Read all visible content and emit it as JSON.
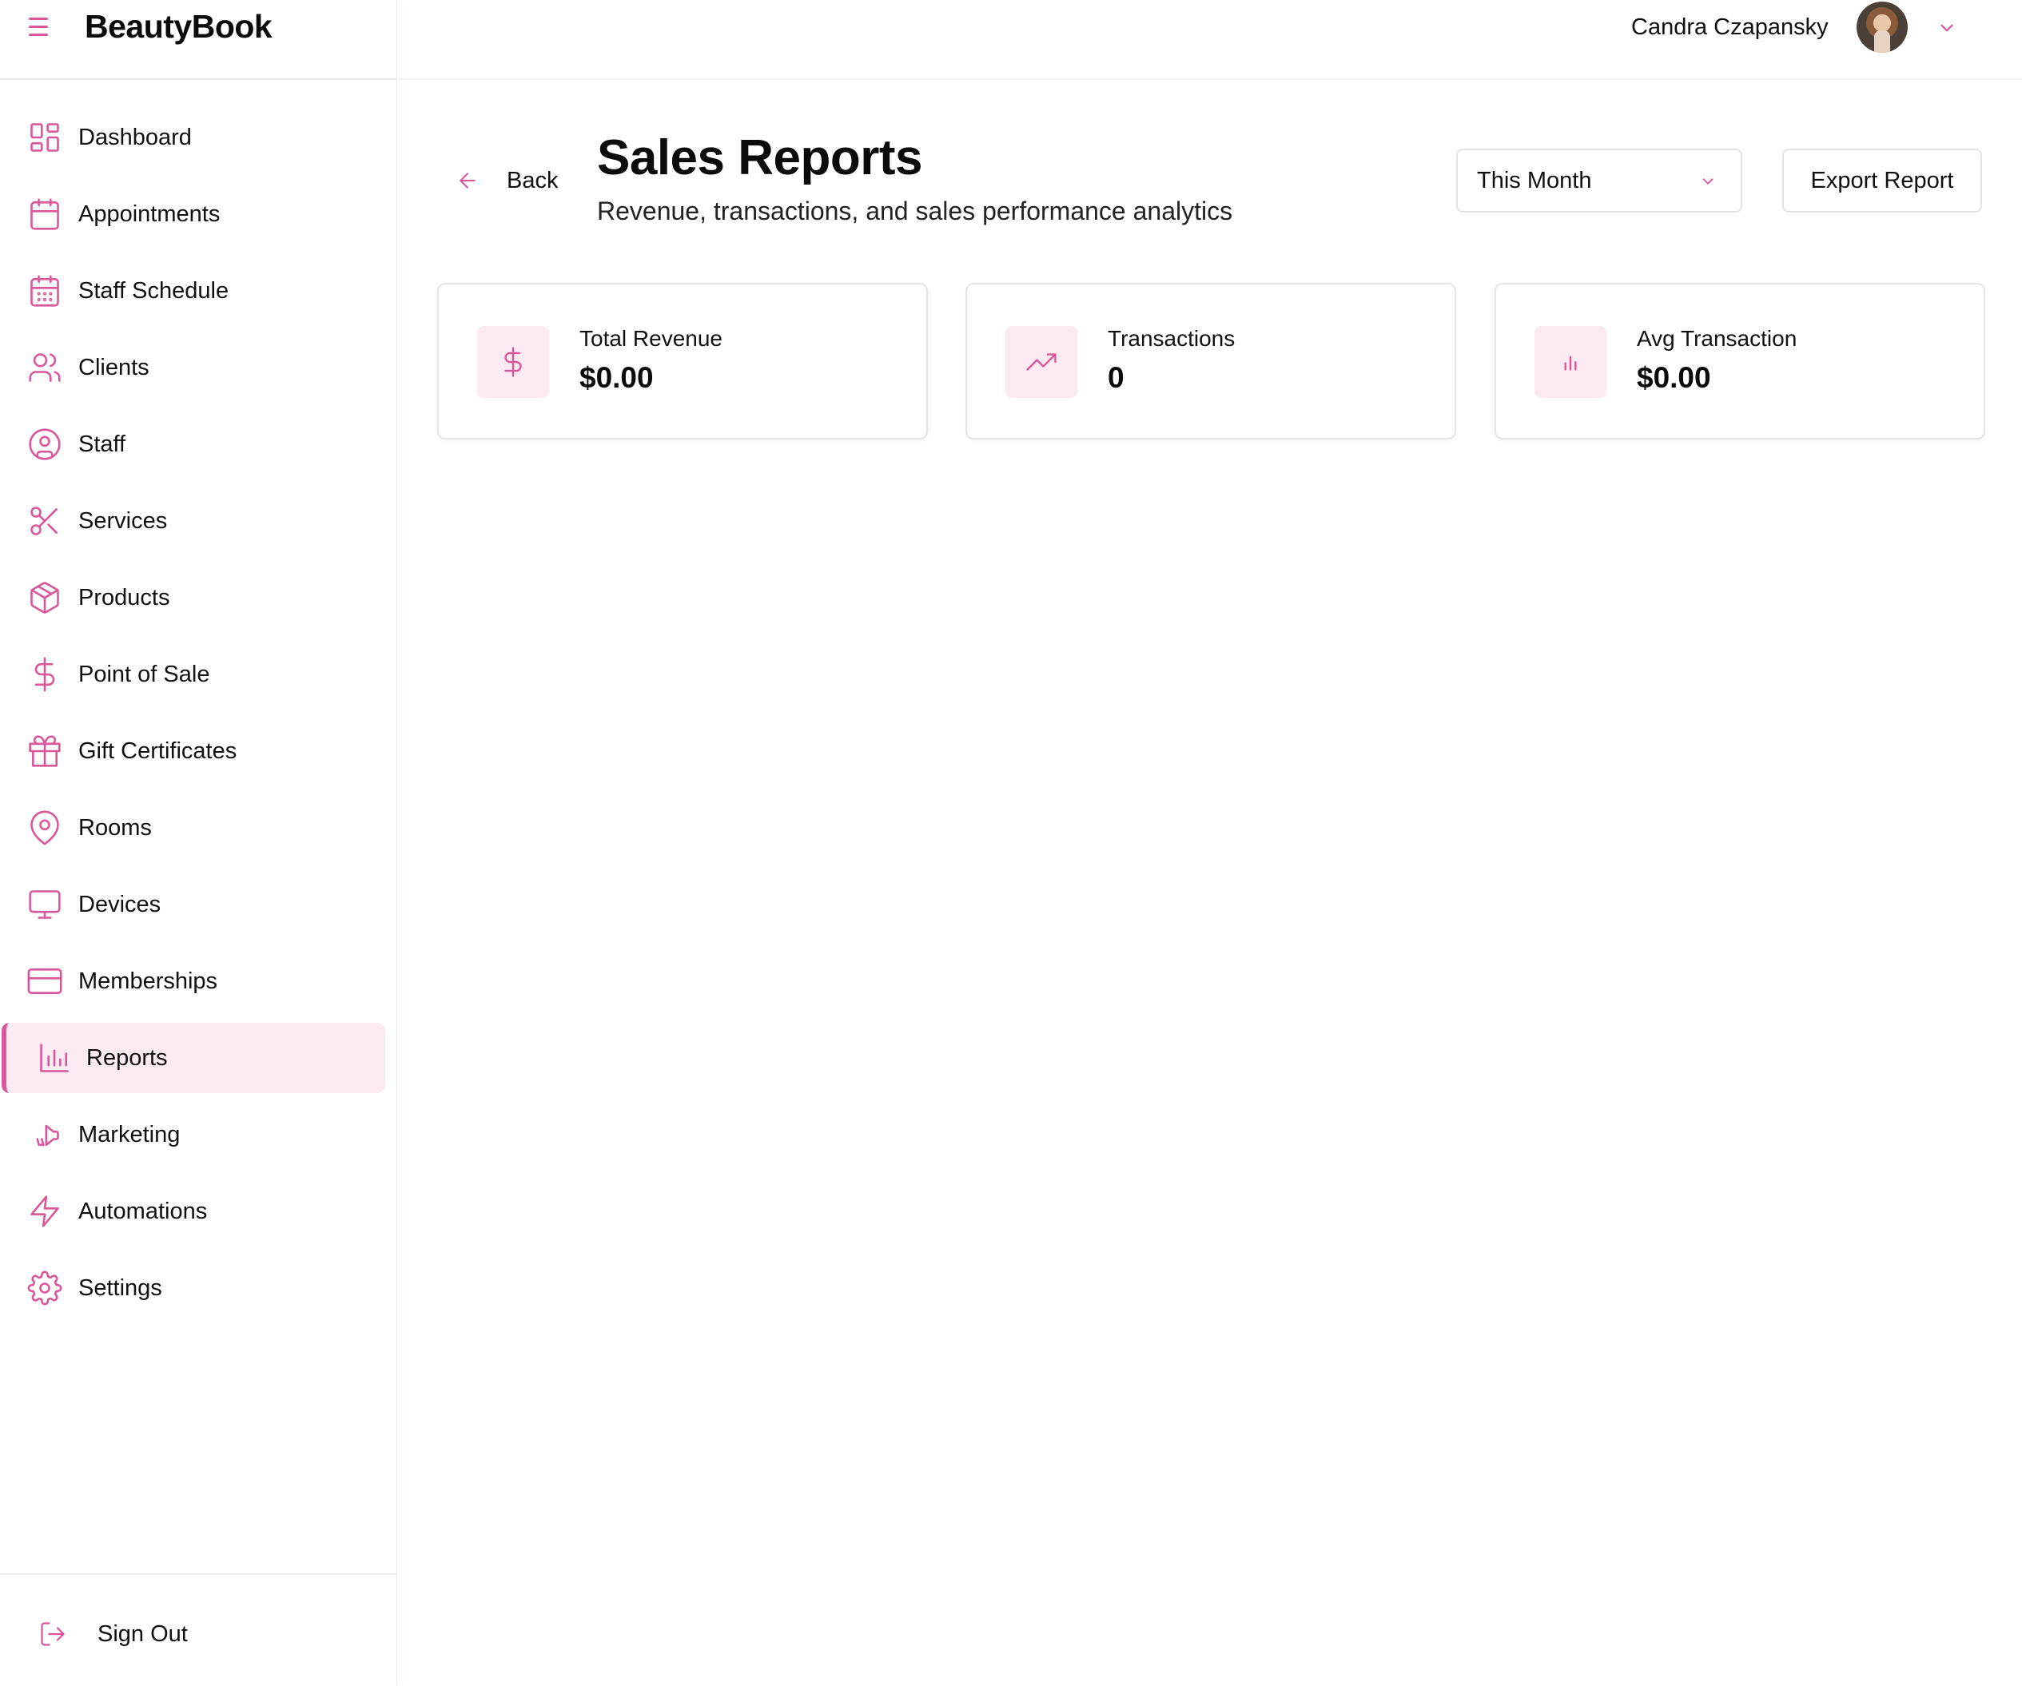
{
  "app": {
    "brand": "BeautyBook"
  },
  "sidebar": {
    "items": [
      {
        "label": "Dashboard",
        "icon": "layout-grid-icon"
      },
      {
        "label": "Appointments",
        "icon": "calendar-icon"
      },
      {
        "label": "Staff Schedule",
        "icon": "calendar-days-icon"
      },
      {
        "label": "Clients",
        "icon": "users-icon"
      },
      {
        "label": "Staff",
        "icon": "user-circle-icon"
      },
      {
        "label": "Services",
        "icon": "scissors-icon"
      },
      {
        "label": "Products",
        "icon": "package-icon"
      },
      {
        "label": "Point of Sale",
        "icon": "dollar-sign-icon"
      },
      {
        "label": "Gift Certificates",
        "icon": "gift-icon"
      },
      {
        "label": "Rooms",
        "icon": "map-pin-icon"
      },
      {
        "label": "Devices",
        "icon": "monitor-icon"
      },
      {
        "label": "Memberships",
        "icon": "credit-card-icon"
      },
      {
        "label": "Reports",
        "icon": "bar-chart-icon",
        "active": true
      },
      {
        "label": "Marketing",
        "icon": "megaphone-icon"
      },
      {
        "label": "Automations",
        "icon": "zap-icon"
      },
      {
        "label": "Settings",
        "icon": "gear-icon"
      }
    ],
    "sign_out": "Sign Out"
  },
  "header": {
    "user_name": "Candra Czapansky"
  },
  "page": {
    "back_label": "Back",
    "title": "Sales Reports",
    "subtitle": "Revenue, transactions, and sales performance analytics",
    "period_selected": "This Month",
    "export_label": "Export Report"
  },
  "stats": [
    {
      "label": "Total Revenue",
      "value": "$0.00",
      "icon": "dollar-sign-icon"
    },
    {
      "label": "Transactions",
      "value": "0",
      "icon": "trending-up-icon"
    },
    {
      "label": "Avg Transaction",
      "value": "$0.00",
      "icon": "bar-chart-icon"
    }
  ],
  "colors": {
    "accent": "#d9569a",
    "accent_soft": "#fbeaf2",
    "text": "#111111",
    "border": "#e3e3e3"
  }
}
